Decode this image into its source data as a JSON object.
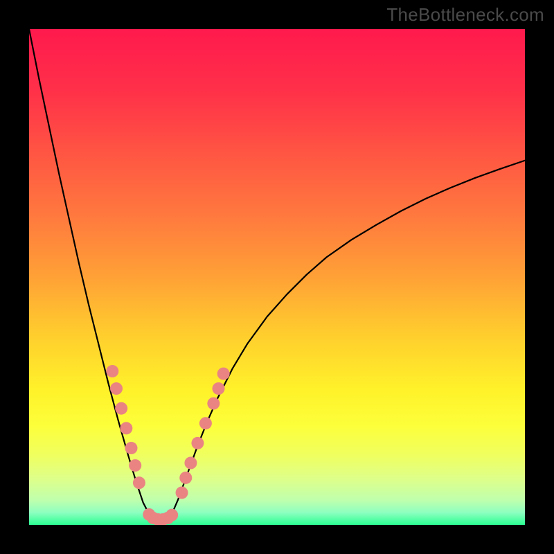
{
  "watermark": "TheBottleneck.com",
  "colors": {
    "gradient_stops": [
      {
        "offset": 0.0,
        "color": "#ff1a4d"
      },
      {
        "offset": 0.12,
        "color": "#ff2f49"
      },
      {
        "offset": 0.25,
        "color": "#ff5543"
      },
      {
        "offset": 0.38,
        "color": "#ff7a3e"
      },
      {
        "offset": 0.5,
        "color": "#ffa136"
      },
      {
        "offset": 0.62,
        "color": "#ffcf2d"
      },
      {
        "offset": 0.73,
        "color": "#fff22a"
      },
      {
        "offset": 0.8,
        "color": "#fcff3a"
      },
      {
        "offset": 0.86,
        "color": "#f0ff60"
      },
      {
        "offset": 0.91,
        "color": "#dcff8c"
      },
      {
        "offset": 0.95,
        "color": "#bfffad"
      },
      {
        "offset": 0.975,
        "color": "#8dffc0"
      },
      {
        "offset": 1.0,
        "color": "#2bff92"
      }
    ],
    "curve": "#000000",
    "curve_width": 2.2,
    "marker_fill": "#e98483",
    "marker_radius": 9
  },
  "chart_data": {
    "type": "line",
    "title": "",
    "xlabel": "",
    "ylabel": "",
    "xlim": [
      0,
      100
    ],
    "ylim": [
      0,
      100
    ],
    "grid": false,
    "legend": false,
    "series": [
      {
        "name": "left-curve",
        "x": [
          0,
          2,
          4,
          6,
          8,
          10,
          12,
          14,
          16,
          18,
          20,
          21.5,
          23,
          24.3
        ],
        "y": [
          100,
          90,
          80.5,
          71,
          62,
          53,
          44.5,
          36.5,
          28.5,
          21,
          14,
          9,
          4.5,
          2
        ]
      },
      {
        "name": "valley-floor",
        "x": [
          24.3,
          25,
          26,
          27,
          28,
          28.7
        ],
        "y": [
          2,
          1.4,
          1.1,
          1.1,
          1.4,
          2
        ]
      },
      {
        "name": "right-curve",
        "x": [
          28.7,
          30,
          32,
          34,
          36,
          38,
          41,
          44,
          48,
          52,
          56,
          60,
          65,
          70,
          75,
          80,
          85,
          90,
          95,
          100
        ],
        "y": [
          2,
          5,
          10.5,
          16,
          21,
          25.5,
          31.5,
          36.5,
          42,
          46.5,
          50.5,
          54,
          57.5,
          60.5,
          63.3,
          65.8,
          68,
          70,
          71.8,
          73.5
        ]
      }
    ],
    "markers": [
      {
        "x": 16.8,
        "y": 31.0
      },
      {
        "x": 17.6,
        "y": 27.5
      },
      {
        "x": 18.6,
        "y": 23.5
      },
      {
        "x": 19.6,
        "y": 19.5
      },
      {
        "x": 20.6,
        "y": 15.5
      },
      {
        "x": 21.4,
        "y": 12.0
      },
      {
        "x": 22.2,
        "y": 8.5
      },
      {
        "x": 24.2,
        "y": 2.1
      },
      {
        "x": 25.0,
        "y": 1.4
      },
      {
        "x": 26.0,
        "y": 1.1
      },
      {
        "x": 27.0,
        "y": 1.1
      },
      {
        "x": 28.0,
        "y": 1.4
      },
      {
        "x": 28.8,
        "y": 2.0
      },
      {
        "x": 30.8,
        "y": 6.5
      },
      {
        "x": 31.6,
        "y": 9.5
      },
      {
        "x": 32.6,
        "y": 12.5
      },
      {
        "x": 34.0,
        "y": 16.5
      },
      {
        "x": 35.6,
        "y": 20.5
      },
      {
        "x": 37.2,
        "y": 24.5
      },
      {
        "x": 38.2,
        "y": 27.5
      },
      {
        "x": 39.2,
        "y": 30.5
      }
    ]
  }
}
